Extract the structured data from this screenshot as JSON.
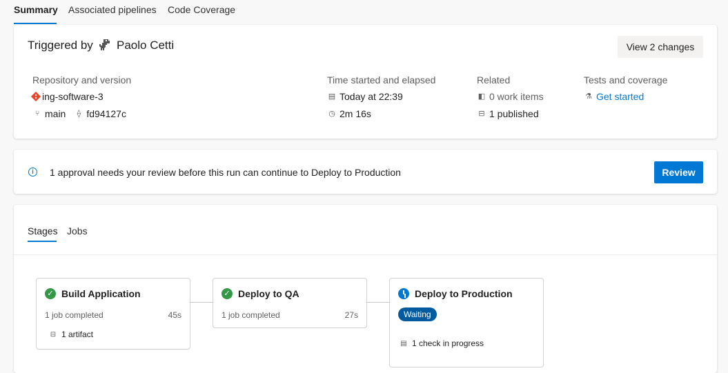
{
  "tabs": [
    "Summary",
    "Associated pipelines",
    "Code Coverage"
  ],
  "summary": {
    "triggered_by_label": "Triggered by",
    "user_name": "Paolo Cetti",
    "view_changes_label": "View 2 changes",
    "repository": {
      "header": "Repository and version",
      "repo_name": "ing-software-3",
      "branch": "main",
      "commit": "fd94127c",
      "icons": [
        "git-repo-icon",
        "branch-icon",
        "commit-icon"
      ]
    },
    "time": {
      "header": "Time started and elapsed",
      "started": "Today at 22:39",
      "elapsed": "2m 16s"
    },
    "related": {
      "header": "Related",
      "work_items": "0 work items",
      "published": "1 published"
    },
    "tests": {
      "header": "Tests and coverage",
      "link": "Get started"
    }
  },
  "approval": {
    "message": "1 approval needs your review before this run can continue to Deploy to Production",
    "button": "Review"
  },
  "stages_panel": {
    "tabs": [
      "Stages",
      "Jobs"
    ],
    "stages": [
      {
        "name": "Build Application",
        "status": "succeeded",
        "detail": "1 job completed",
        "duration": "45s",
        "extra": "1 artifact"
      },
      {
        "name": "Deploy to QA",
        "status": "succeeded",
        "detail": "1 job completed",
        "duration": "27s"
      },
      {
        "name": "Deploy to Production",
        "status": "waiting",
        "badge": "Waiting",
        "extra": "1 check in progress"
      }
    ]
  },
  "colors": {
    "accent": "#0078d4",
    "success": "#339947",
    "badge": "#005a9e",
    "git_icon": "#e8462b"
  }
}
